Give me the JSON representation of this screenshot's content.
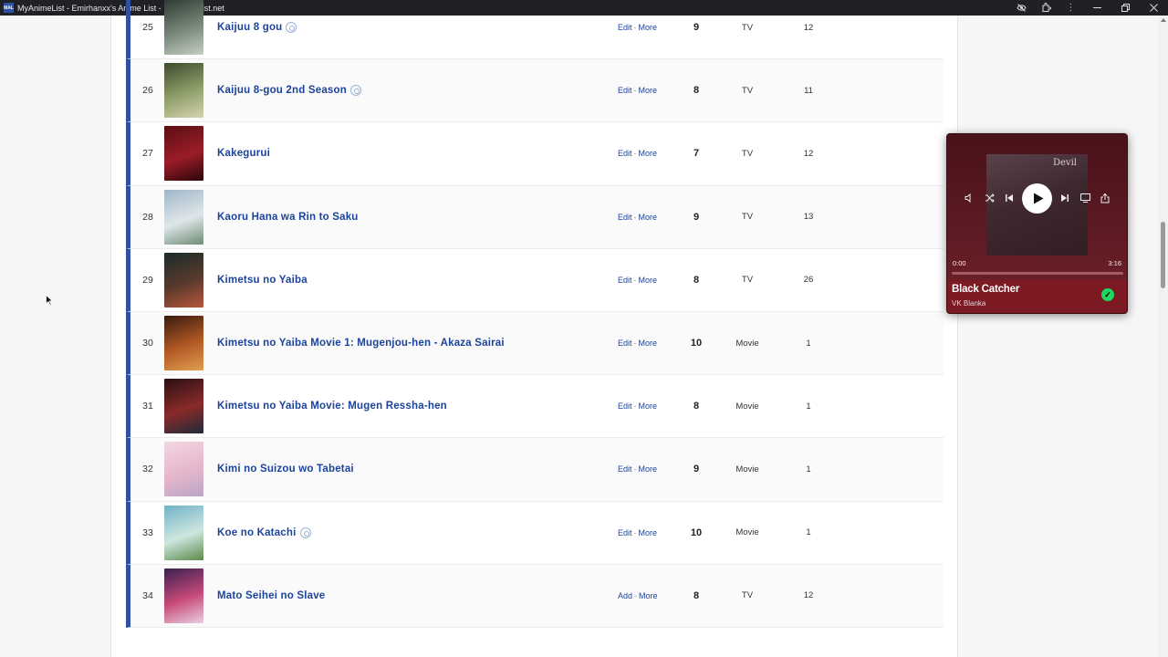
{
  "window": {
    "title": "MyAnimeList - Emirhanxx's Anime List - MyAnimeList.net",
    "favicon": "MAL"
  },
  "rows": [
    {
      "num": "25",
      "title": "Kaijuu 8 gou",
      "airing": true,
      "action": "Edit",
      "more": "More",
      "score": "9",
      "type": "TV",
      "progress": "12",
      "colors": [
        "#2f3a33",
        "#7a8a7c",
        "#c6cfc4"
      ]
    },
    {
      "num": "26",
      "title": "Kaijuu 8-gou 2nd Season",
      "airing": true,
      "action": "Edit",
      "more": "More",
      "score": "8",
      "type": "TV",
      "progress": "11",
      "colors": [
        "#3d4a2e",
        "#8fa06a",
        "#d7d2b0"
      ]
    },
    {
      "num": "27",
      "title": "Kakegurui",
      "airing": false,
      "action": "Edit",
      "more": "More",
      "score": "7",
      "type": "TV",
      "progress": "12",
      "colors": [
        "#5a0e14",
        "#9b1d28",
        "#2a0608"
      ]
    },
    {
      "num": "28",
      "title": "Kaoru Hana wa Rin to Saku",
      "airing": false,
      "action": "Edit",
      "more": "More",
      "score": "9",
      "type": "TV",
      "progress": "13",
      "colors": [
        "#9fb6c8",
        "#dfe6ea",
        "#6d8b72"
      ]
    },
    {
      "num": "29",
      "title": "Kimetsu no Yaiba",
      "airing": false,
      "action": "Edit",
      "more": "More",
      "score": "8",
      "type": "TV",
      "progress": "26",
      "colors": [
        "#1a2b2a",
        "#5a3a2c",
        "#b8563a"
      ]
    },
    {
      "num": "30",
      "title": "Kimetsu no Yaiba Movie 1: Mugenjou-hen - Akaza Sairai",
      "airing": false,
      "action": "Edit",
      "more": "More",
      "score": "10",
      "type": "Movie",
      "progress": "1",
      "colors": [
        "#3a1a10",
        "#b35a25",
        "#e0a050"
      ]
    },
    {
      "num": "31",
      "title": "Kimetsu no Yaiba Movie: Mugen Ressha-hen",
      "airing": false,
      "action": "Edit",
      "more": "More",
      "score": "8",
      "type": "Movie",
      "progress": "1",
      "colors": [
        "#2a1012",
        "#8a2a2a",
        "#1d2a3a"
      ]
    },
    {
      "num": "32",
      "title": "Kimi no Suizou wo Tabetai",
      "airing": false,
      "action": "Edit",
      "more": "More",
      "score": "9",
      "type": "Movie",
      "progress": "1",
      "colors": [
        "#f2d6e4",
        "#e6b6ca",
        "#b9a6c8"
      ]
    },
    {
      "num": "33",
      "title": "Koe no Katachi",
      "airing": true,
      "action": "Edit",
      "more": "More",
      "score": "10",
      "type": "Movie",
      "progress": "1",
      "colors": [
        "#6fb2c8",
        "#cfe6de",
        "#5a8a4a"
      ]
    },
    {
      "num": "34",
      "title": "Mato Seihei no Slave",
      "airing": false,
      "action": "Add",
      "more": "More",
      "score": "8",
      "type": "TV",
      "progress": "12",
      "colors": [
        "#3a2050",
        "#c84a7a",
        "#e8d0e0"
      ]
    }
  ],
  "player": {
    "cover_text": "Devil",
    "time_current": "0:00",
    "time_total": "3:16",
    "song": "Black Catcher",
    "artist": "VK Blanka",
    "check_glyph": "✓",
    "accent": "#1ed760",
    "bg": "#7b1a23"
  }
}
